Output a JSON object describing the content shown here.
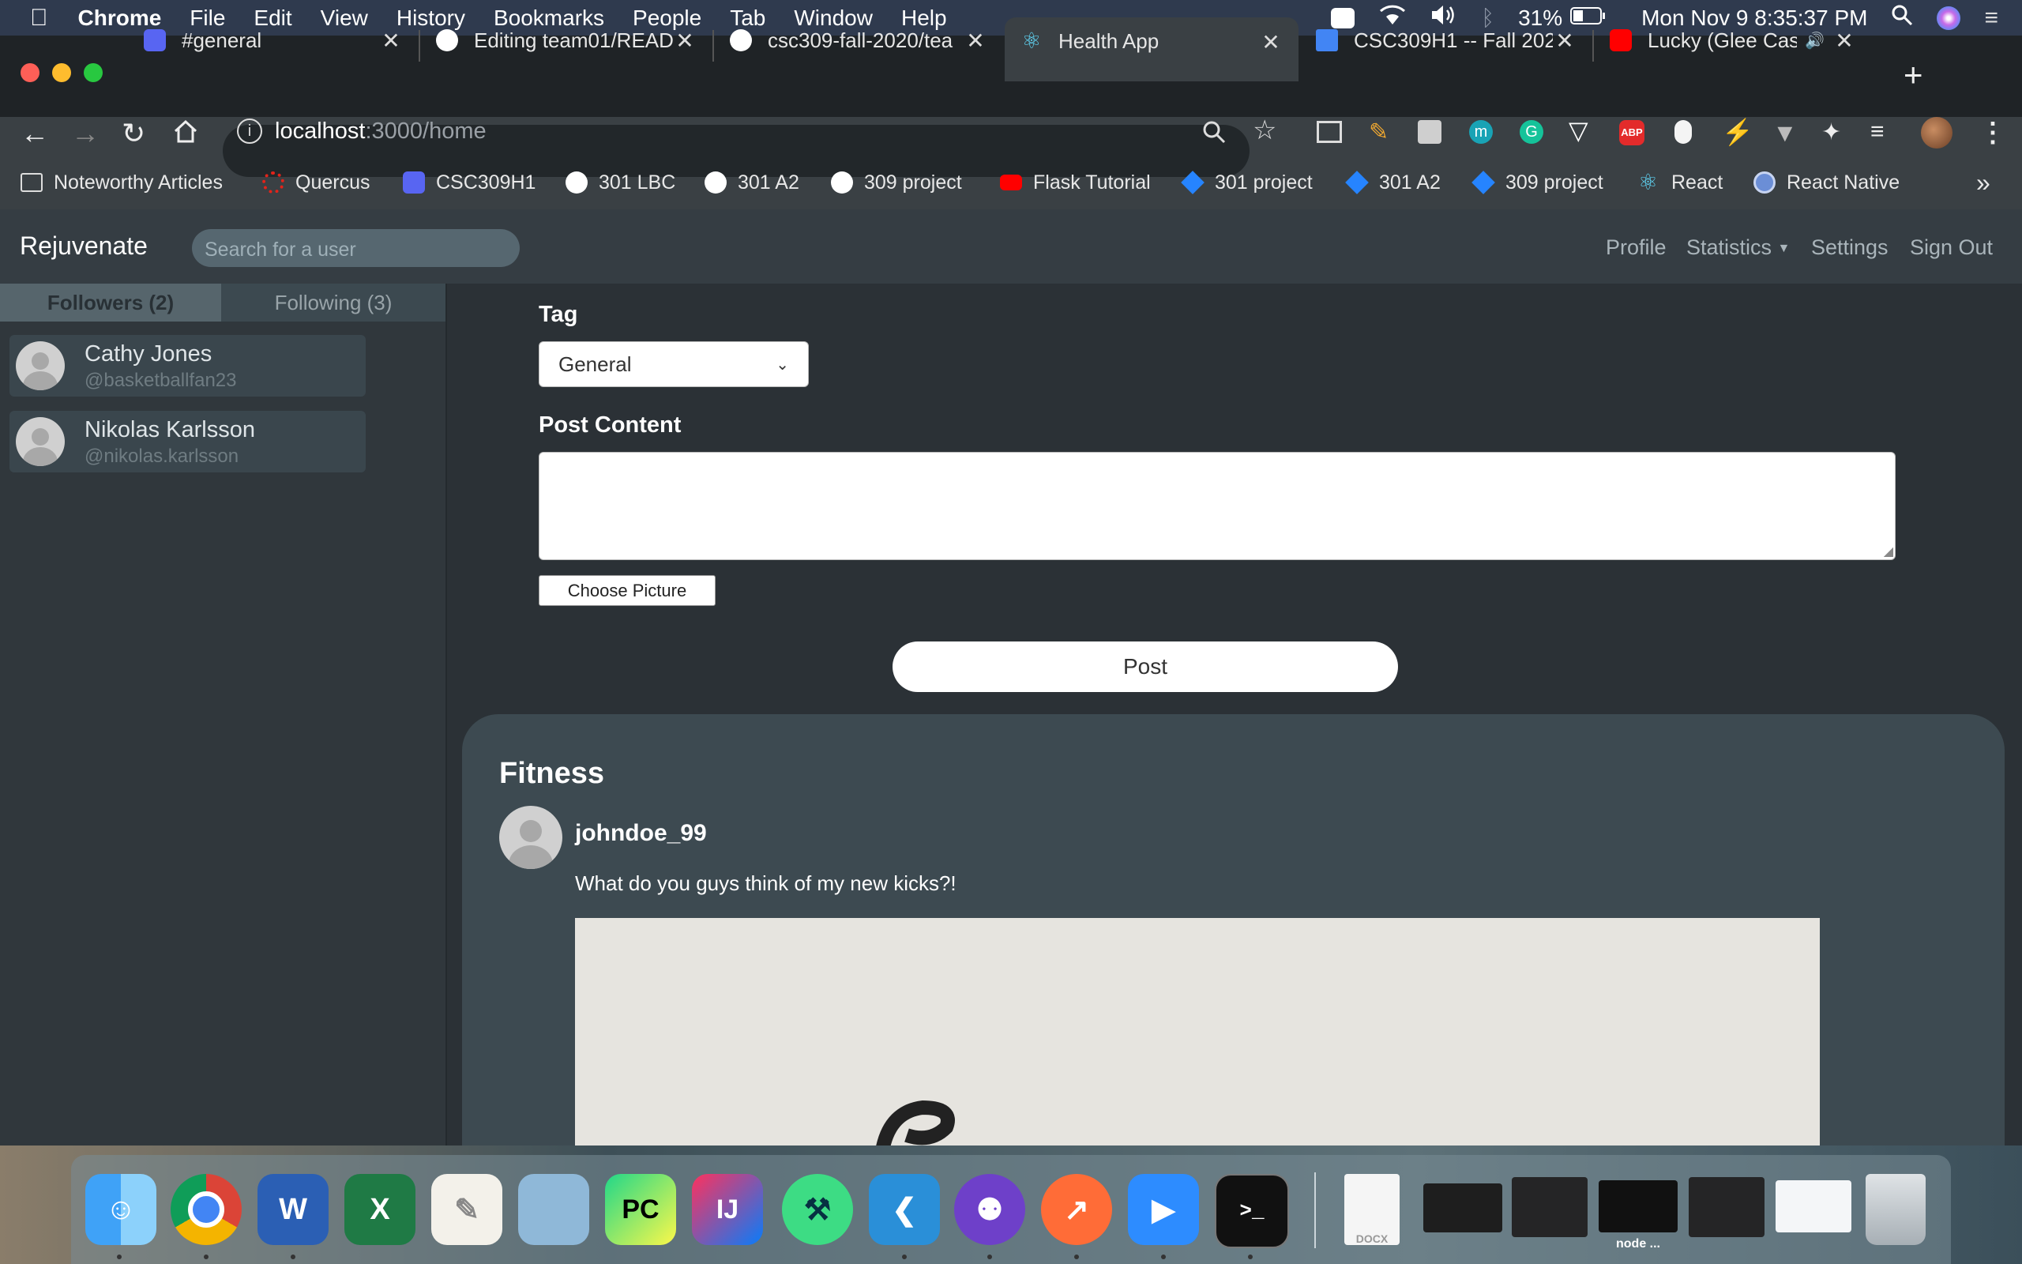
{
  "menubar": {
    "apple": "",
    "app": "Chrome",
    "items": [
      "File",
      "Edit",
      "View",
      "History",
      "Bookmarks",
      "People",
      "Tab",
      "Window",
      "Help"
    ],
    "battery": "31%",
    "datetime": "Mon Nov 9  8:35:37 PM"
  },
  "tabs": [
    {
      "title": "#general",
      "icon_color": "#e8413e"
    },
    {
      "title": "Editing team01/READ",
      "icon_color": "#ffffff"
    },
    {
      "title": "csc309-fall-2020/tea",
      "icon_color": "#ffffff"
    },
    {
      "title": "Health App",
      "icon_color": "#61dafb"
    },
    {
      "title": "CSC309H1 -- Fall 202",
      "icon_color": "#4285f4"
    },
    {
      "title": "Lucky (Glee Cast",
      "icon_color": "#ff0000"
    }
  ],
  "url": {
    "host": "localhost",
    "path": ":3000/home"
  },
  "bookmarks": [
    {
      "label": "Noteworthy Articles",
      "icon": "folder-icon"
    },
    {
      "label": "Quercus",
      "icon": "quercus-icon"
    },
    {
      "label": "CSC309H1",
      "icon": "piazza-icon"
    },
    {
      "label": "301 LBC",
      "icon": "github-icon"
    },
    {
      "label": "301 A2",
      "icon": "github-icon"
    },
    {
      "label": "309 project",
      "icon": "github-icon"
    },
    {
      "label": "Flask Tutorial",
      "icon": "youtube-icon"
    },
    {
      "label": "301 project",
      "icon": "jira-icon"
    },
    {
      "label": "301 A2",
      "icon": "jira-icon"
    },
    {
      "label": "309 project",
      "icon": "jira-icon"
    },
    {
      "label": "React",
      "icon": "react-icon"
    },
    {
      "label": "React Native",
      "icon": "react-native-icon"
    }
  ],
  "bookmarks_overflow": "»",
  "app": {
    "brand": "Rejuvenate",
    "search_placeholder": "Search for a user",
    "nav": {
      "profile": "Profile",
      "statistics": "Statistics",
      "settings": "Settings",
      "signout": "Sign Out"
    },
    "side_tabs": {
      "followers": "Followers (2)",
      "following": "Following (3)"
    },
    "people": [
      {
        "name": "Cathy Jones",
        "handle": "@basketballfan23"
      },
      {
        "name": "Nikolas Karlsson",
        "handle": "@nikolas.karlsson"
      }
    ],
    "form": {
      "tag_label": "Tag",
      "tag_value": "General",
      "content_label": "Post Content",
      "choose_picture": "Choose Picture",
      "post_button": "Post"
    },
    "post": {
      "tag": "Fitness",
      "username": "johndoe_99",
      "text": "What do you guys think of my new kicks?!"
    }
  },
  "dock": {
    "node_label": "node ...",
    "docx_label": "DOCX"
  }
}
